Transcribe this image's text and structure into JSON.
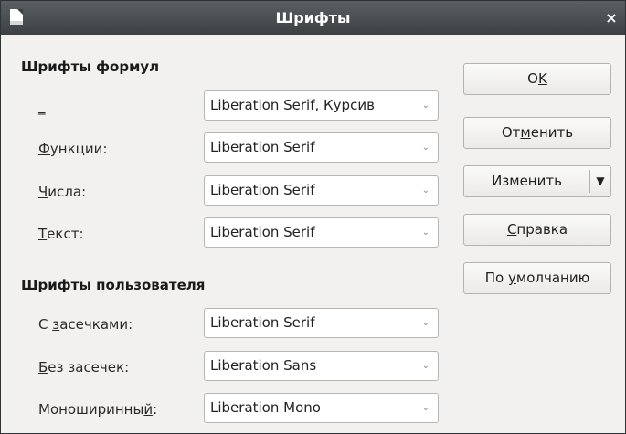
{
  "window": {
    "title": "Шрифты",
    "close_glyph": "×",
    "app_icon": "document-icon"
  },
  "formula_fonts": {
    "heading": "Шрифты формул",
    "rows": [
      {
        "pre": "",
        "key": "_",
        "post": "",
        "value": "Liberation Serif, Курсив"
      },
      {
        "pre": "",
        "key": "Ф",
        "post": "ункции:",
        "value": "Liberation Serif"
      },
      {
        "pre": "",
        "key": "Ч",
        "post": "исла:",
        "value": "Liberation Serif"
      },
      {
        "pre": "",
        "key": "Т",
        "post": "екст:",
        "value": "Liberation Serif"
      }
    ]
  },
  "user_fonts": {
    "heading": "Шрифты пользователя",
    "rows": [
      {
        "pre": "С ",
        "key": "з",
        "post": "асечками:",
        "value": "Liberation Serif"
      },
      {
        "pre": "",
        "key": "Б",
        "post": "ез засечек:",
        "value": "Liberation Sans"
      },
      {
        "pre": "Моноширинны",
        "key": "й",
        "post": ":",
        "value": "Liberation Mono"
      }
    ]
  },
  "buttons": {
    "ok": {
      "pre": "O",
      "key": "K",
      "post": ""
    },
    "cancel": {
      "pre": "От",
      "key": "м",
      "post": "енить"
    },
    "modify": {
      "label": "Изменить",
      "dropdown_glyph": "▼"
    },
    "help": {
      "pre": "",
      "key": "С",
      "post": "правка"
    },
    "default": {
      "pre": "По ",
      "key": "у",
      "post": "молчанию"
    }
  },
  "combo_arrow": "⌄"
}
